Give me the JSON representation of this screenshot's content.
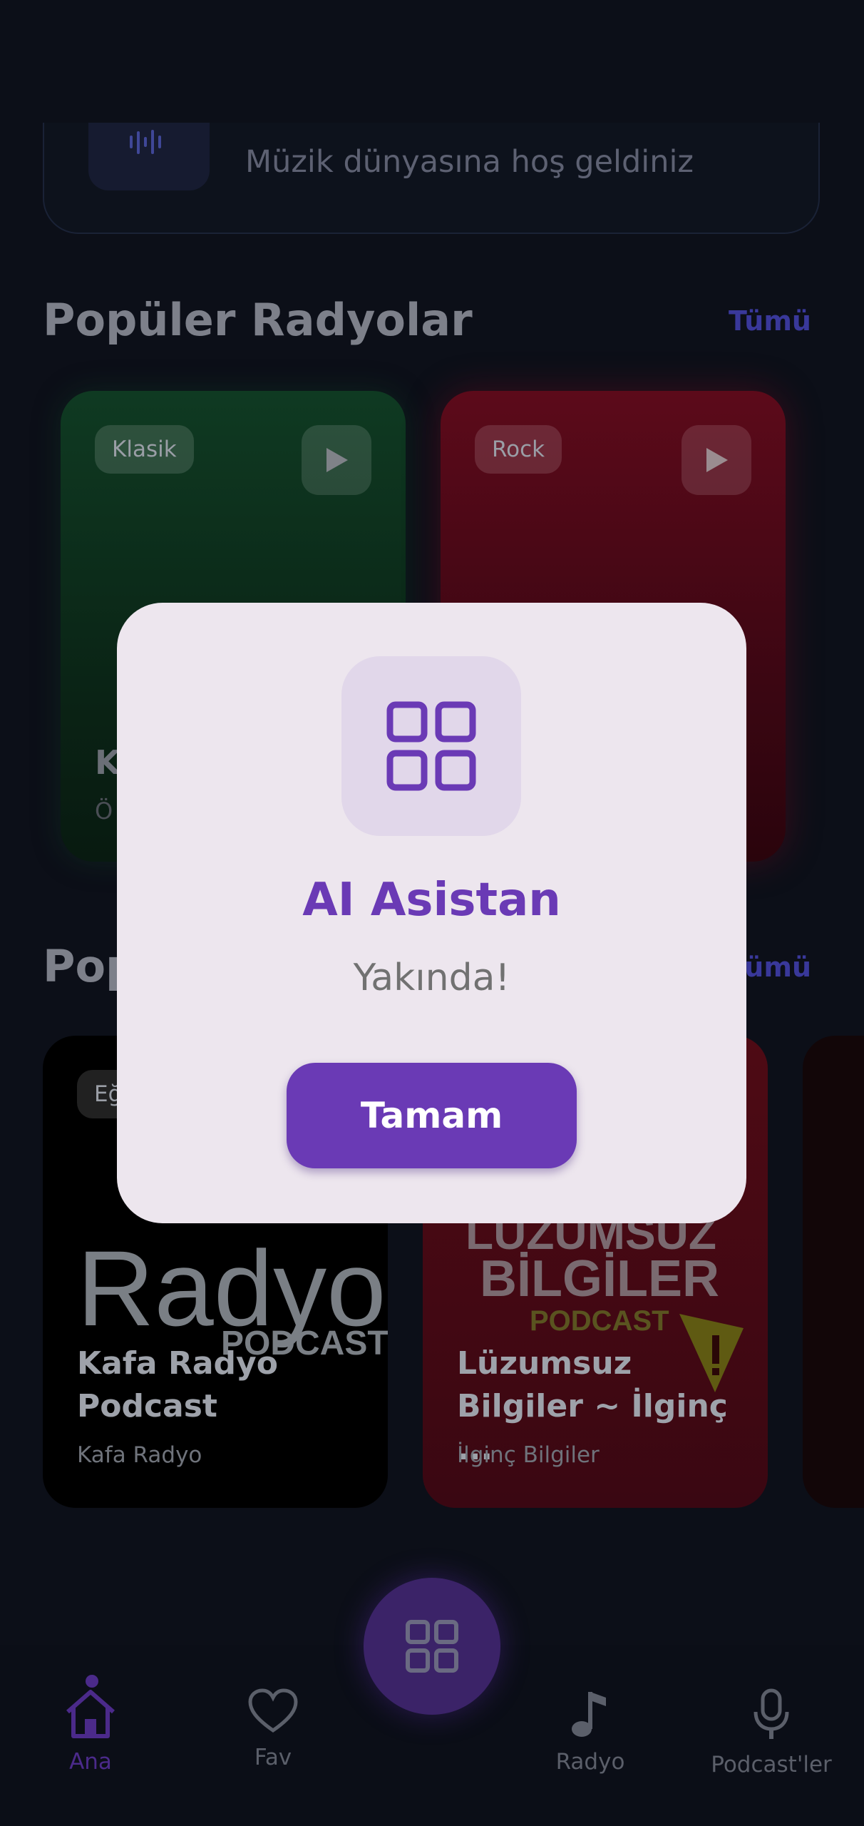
{
  "welcome": {
    "subtitle": "Müzik dünyasına hoş geldiniz"
  },
  "popular_radios": {
    "title": "Popüler Radyolar",
    "see_all": "Tümü",
    "cards": [
      {
        "tag": "Klasik",
        "title_fragment": "K",
        "subtitle_fragment": "Ö"
      },
      {
        "tag": "Rock"
      }
    ]
  },
  "popular_podcasts": {
    "title_fragment": "Pop",
    "see_all_fragment": "ümü",
    "cards": [
      {
        "tag_fragment": "Eğ",
        "title": "Kafa Radyo Podcast",
        "subtitle": "Kafa Radyo",
        "art_text": "Radyo",
        "art_sub": "PODCAST"
      },
      {
        "title": "Lüzumsuz Bilgiler ~ İlginç ...",
        "subtitle": "İlginç Bilgiler",
        "art_line1": "LÜZUMSUZ",
        "art_line2": "BİLGİLER",
        "art_line3": "PODCAST"
      }
    ]
  },
  "bottom_nav": {
    "items": [
      {
        "label": "Ana",
        "icon": "home-icon",
        "active": true
      },
      {
        "label": "Fav",
        "icon": "heart-icon"
      },
      {
        "label": "Radyo",
        "icon": "music-note-icon"
      },
      {
        "label": "Podcast'ler",
        "icon": "microphone-icon"
      }
    ]
  },
  "modal": {
    "title": "AI Asistan",
    "message": "Yakında!",
    "button_label": "Tamam",
    "icon": "grid-icon"
  },
  "colors": {
    "accent": "#6a3ab5",
    "background": "#0c0f18",
    "modal_bg": "#ede6ee"
  }
}
